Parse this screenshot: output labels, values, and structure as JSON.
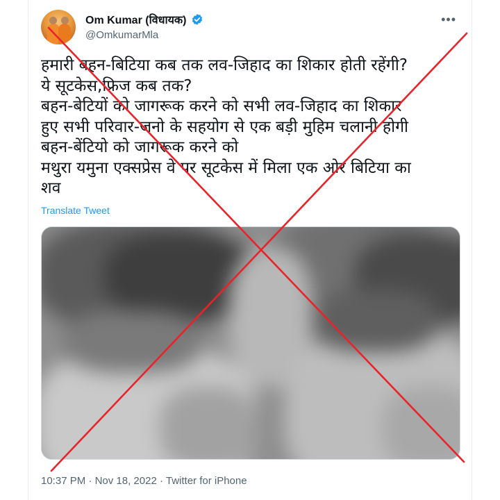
{
  "author": {
    "display_name": "Om Kumar (विधायक)",
    "handle": "@OmkumarMla",
    "verified_icon": "verified-badge-icon",
    "avatar_icon": "profile-avatar"
  },
  "more_icon": "more-options-icon",
  "tweet": {
    "lines": [
      "हमारी बहन-बिटिया कब तक लव-जिहाद का शिकार होती रहेंगी?",
      "ये सूटकेस,फ्रिज कब तक?",
      "बहन-बेटियों को जागरूक करने को सभी लव-जिहाद का शिकार",
      "हुए सभी परिवार-जनो के सहयोग से एक बड़ी मुहिम चलानी होगी",
      "बहन-बेंटियो को जागरूक करने को",
      "मथुरा यमुना एक्सप्रेस वे पर सूटकेस में मिला एक ओर बिटिया का",
      "शव"
    ],
    "translate_label": "Translate Tweet"
  },
  "media": {
    "description_icon": "blurred-photo"
  },
  "meta": {
    "time": "10:37 PM",
    "separator": " · ",
    "date": "Nov 18, 2022",
    "source": "Twitter for iPhone"
  },
  "colors": {
    "accent": "#1d9bf0",
    "cross": "#e8232a",
    "text": "#0f1419",
    "muted": "#536471"
  }
}
